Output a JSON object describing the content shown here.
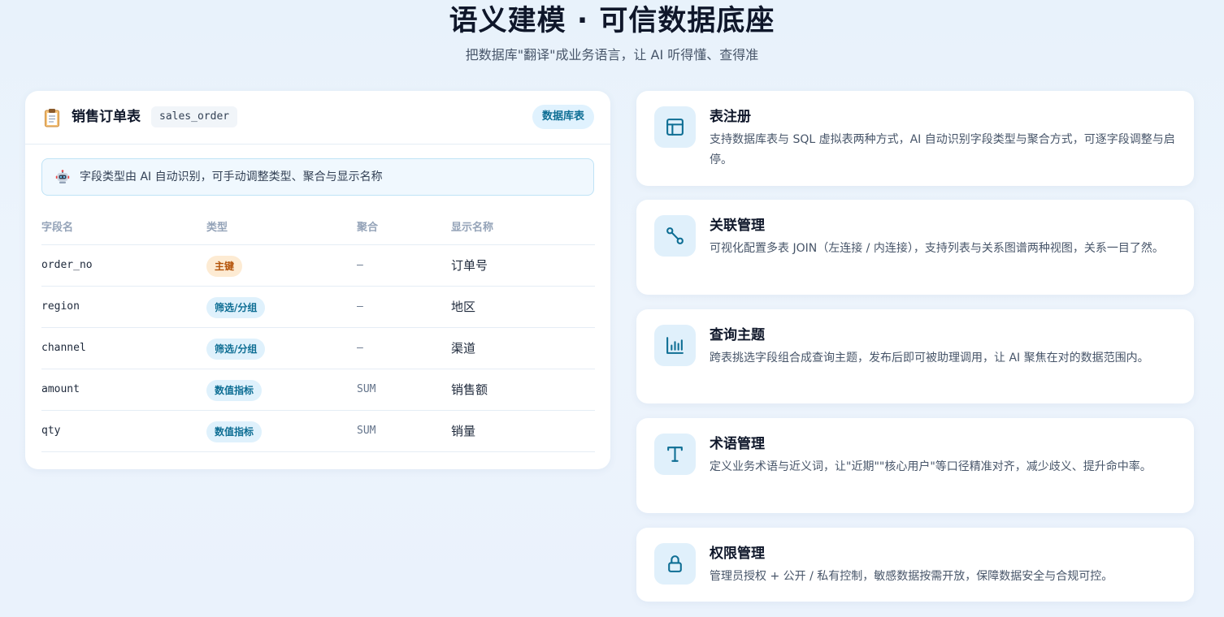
{
  "header": {
    "title": "语义建模 · 可信数据底座",
    "subtitle": "把数据库\"翻译\"成业务语言，让 AI 听得懂、查得准"
  },
  "table_card": {
    "icon": "clipboard-icon",
    "title": "销售订单表",
    "table_name": "sales_order",
    "source_badge": "数据库表",
    "ai_notice": {
      "icon": "robot-icon",
      "text": "字段类型由 AI 自动识别，可手动调整类型、聚合与显示名称"
    },
    "columns": [
      "字段名",
      "类型",
      "聚合",
      "显示名称"
    ],
    "rows": [
      {
        "field": "order_no",
        "type": "主键",
        "agg": "—",
        "display": "订单号"
      },
      {
        "field": "region",
        "type": "筛选/分组",
        "agg": "—",
        "display": "地区"
      },
      {
        "field": "channel",
        "type": "筛选/分组",
        "agg": "—",
        "display": "渠道"
      },
      {
        "field": "amount",
        "type": "数值指标",
        "agg": "SUM",
        "display": "销售额"
      },
      {
        "field": "qty",
        "type": "数值指标",
        "agg": "SUM",
        "display": "销量"
      }
    ]
  },
  "features": [
    {
      "icon": "table-icon",
      "title": "表注册",
      "desc": "支持数据库表与 SQL 虚拟表两种方式，AI 自动识别字段类型与聚合方式，可逐字段调整与启停。"
    },
    {
      "icon": "link-icon",
      "title": "关联管理",
      "desc": "可视化配置多表 JOIN（左连接 / 内连接），支持列表与关系图谱两种视图，关系一目了然。"
    },
    {
      "icon": "bar-chart-icon",
      "title": "查询主题",
      "desc": "跨表挑选字段组合成查询主题，发布后即可被助理调用，让 AI 聚焦在对的数据范围内。"
    },
    {
      "icon": "text-icon",
      "title": "术语管理",
      "desc": "定义业务术语与近义词，让\"近期\"\"核心用户\"等口径精准对齐，减少歧义、提升命中率。"
    },
    {
      "icon": "lock-icon",
      "title": "权限管理",
      "desc": "管理员授权 + 公开 / 私有控制，敏感数据按需开放，保障数据安全与合规可控。"
    }
  ],
  "colors": {
    "accent": "#0e6e94",
    "badge_bg": "#e0f2fe",
    "pk_bg": "#fdebd3",
    "pk_text": "#b45309"
  }
}
